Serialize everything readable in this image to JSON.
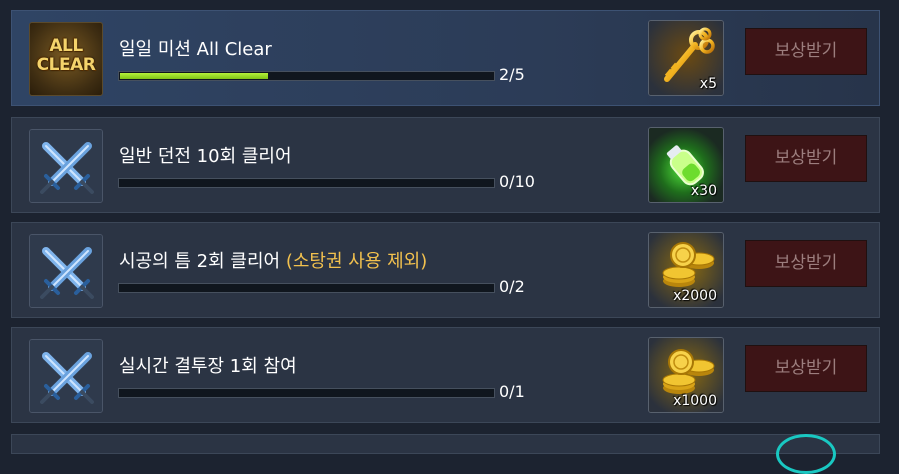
{
  "missions": [
    {
      "title": "일일 미션 All Clear",
      "title_highlight": "",
      "icon": "all-clear-badge-icon",
      "icon_text": [
        "ALL",
        "CLEAR"
      ],
      "progress_text": "2/5",
      "progress_fraction": 0.4,
      "reward_icon": "golden-key-icon",
      "reward_qty": "x5",
      "button_label": "보상받기",
      "highlighted": true
    },
    {
      "title": "일반 던전 10회 클리어",
      "title_highlight": "",
      "icon": "crossed-swords-icon",
      "progress_text": "0/10",
      "progress_fraction": 0,
      "reward_icon": "green-potion-icon",
      "reward_qty": "x30",
      "button_label": "보상받기",
      "highlighted": false
    },
    {
      "title": "시공의 틈 2회 클리어 ",
      "title_highlight": "(소탕권 사용 제외)",
      "icon": "crossed-swords-icon",
      "progress_text": "0/2",
      "progress_fraction": 0,
      "reward_icon": "gold-coins-icon",
      "reward_qty": "x2000",
      "button_label": "보상받기",
      "highlighted": false
    },
    {
      "title": "실시간 결투장 1회 참여",
      "title_highlight": "",
      "icon": "crossed-swords-icon",
      "progress_text": "0/1",
      "progress_fraction": 0,
      "reward_icon": "gold-coins-icon",
      "reward_qty": "x1000",
      "button_label": "보상받기",
      "highlighted": false
    }
  ],
  "colors": {
    "background": "#1c2330",
    "row": "#2b3444",
    "highlight_row": "#2f4464",
    "progress_fill": "#9ddc26",
    "title_highlight": "#f2c14e",
    "button_bg": "#3d1416",
    "button_text": "#9c7e7e"
  }
}
